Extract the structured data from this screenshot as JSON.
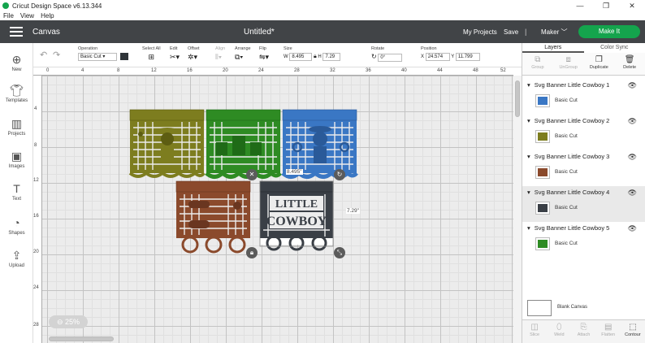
{
  "window": {
    "title": "Cricut Design Space  v6.13.344",
    "menu": [
      "File",
      "View",
      "Help"
    ]
  },
  "header": {
    "section": "Canvas",
    "document_title": "Untitled*",
    "my_projects": "My Projects",
    "save": "Save",
    "separator": "|",
    "machine": "Maker",
    "make_it": "Make It"
  },
  "left_tools": [
    {
      "label": "New",
      "icon": "plus-icon"
    },
    {
      "label": "Templates",
      "icon": "shirt-icon"
    },
    {
      "label": "Projects",
      "icon": "projects-icon"
    },
    {
      "label": "Images",
      "icon": "image-icon"
    },
    {
      "label": "Text",
      "icon": "text-icon"
    },
    {
      "label": "Shapes",
      "icon": "shapes-icon"
    },
    {
      "label": "Upload",
      "icon": "upload-icon"
    }
  ],
  "toolbar": {
    "operation_label": "Operation",
    "operation_value": "Basic Cut",
    "select_all": "Select All",
    "edit": "Edit",
    "offset": "Offset",
    "align": "Align",
    "arrange": "Arrange",
    "flip": "Flip",
    "size_label": "Size",
    "w_label": "W",
    "w_value": "8.495",
    "h_label": "H",
    "h_value": "7.29",
    "rotate_label": "Rotate",
    "rotate_value": "0°",
    "position_label": "Position",
    "x_label": "X",
    "x_value": "24.574",
    "y_label": "Y",
    "y_value": "11.799",
    "operation_color": "#2f3439"
  },
  "ruler": {
    "top": [
      "0",
      "4",
      "8",
      "12",
      "16",
      "20",
      "24",
      "28",
      "32",
      "36",
      "40",
      "44",
      "48",
      "52"
    ],
    "left": [
      "4",
      "8",
      "12",
      "16",
      "20",
      "24",
      "28"
    ]
  },
  "canvas": {
    "zoom": "25%",
    "width_readout": "8.495\"",
    "height_readout": "7.29\"",
    "banners": [
      {
        "name": "Svg Banner Little Cowboy 1",
        "color": "#7d7d1f"
      },
      {
        "name": "Svg Banner Little Cowboy 2",
        "color": "#2e8b23"
      },
      {
        "name": "Svg Banner Little Cowboy 3",
        "color": "#3a77c4"
      },
      {
        "name": "Svg Banner Little Cowboy 4",
        "color": "#8b4a2c"
      },
      {
        "name": "Svg Banner Little Cowboy 5",
        "color": "#3a3f46"
      }
    ],
    "banner_text_line1": "LITTLE",
    "banner_text_line2": "COWBOY"
  },
  "panel": {
    "tabs": [
      "Layers",
      "Color Sync"
    ],
    "actions": [
      "Group",
      "UnGroup",
      "Duplicate",
      "Delete"
    ],
    "layers": [
      {
        "name": "Svg Banner Little Cowboy 1",
        "operation": "Basic Cut",
        "color": "#3a77c4"
      },
      {
        "name": "Svg Banner Little Cowboy 2",
        "operation": "Basic Cut",
        "color": "#7d7d1f"
      },
      {
        "name": "Svg Banner Little Cowboy 3",
        "operation": "Basic Cut",
        "color": "#8b4a2c"
      },
      {
        "name": "Svg Banner Little Cowboy 4",
        "operation": "Basic Cut",
        "color": "#3a3f46"
      },
      {
        "name": "Svg Banner Little Cowboy 5",
        "operation": "Basic Cut",
        "color": "#2e8b23"
      }
    ],
    "selected_layer": 3,
    "blank_canvas": "Blank Canvas",
    "bottom_actions": [
      "Slice",
      "Weld",
      "Attach",
      "Flatten",
      "Contour"
    ]
  }
}
